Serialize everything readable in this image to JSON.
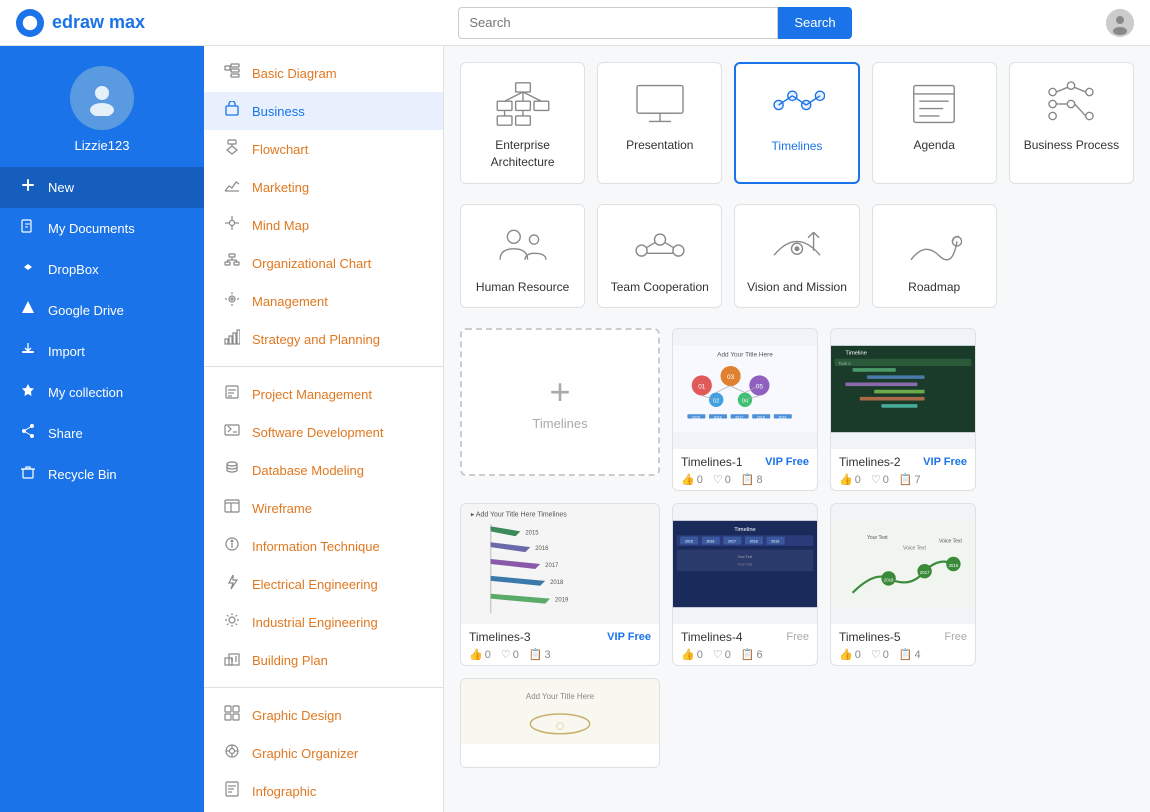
{
  "topbar": {
    "logo_letter": "D",
    "app_name": "edraw max",
    "search_placeholder": "Search",
    "search_button_label": "Search"
  },
  "sidebar": {
    "username": "Lizzie123",
    "nav_items": [
      {
        "id": "new",
        "label": "New",
        "icon": "➕",
        "active": true
      },
      {
        "id": "my-documents",
        "label": "My Documents",
        "icon": "📄"
      },
      {
        "id": "dropbox",
        "label": "DropBox",
        "icon": "📦"
      },
      {
        "id": "google-drive",
        "label": "Google Drive",
        "icon": "🔺"
      },
      {
        "id": "import",
        "label": "Import",
        "icon": "📥"
      },
      {
        "id": "my-collection",
        "label": "My collection",
        "icon": "⭐"
      },
      {
        "id": "share",
        "label": "Share",
        "icon": "🔗"
      },
      {
        "id": "recycle-bin",
        "label": "Recycle Bin",
        "icon": "🗑"
      }
    ]
  },
  "middle_menu": {
    "sections": [
      {
        "items": [
          {
            "id": "basic-diagram",
            "label": "Basic Diagram",
            "icon": "◻"
          },
          {
            "id": "business",
            "label": "Business",
            "icon": "💼",
            "selected": true
          },
          {
            "id": "flowchart",
            "label": "Flowchart",
            "icon": "⬜"
          },
          {
            "id": "marketing",
            "label": "Marketing",
            "icon": "📊"
          },
          {
            "id": "mind-map",
            "label": "Mind Map",
            "icon": "🔷"
          },
          {
            "id": "organizational-chart",
            "label": "Organizational Chart",
            "icon": "🏢"
          },
          {
            "id": "management",
            "label": "Management",
            "icon": "⚙"
          },
          {
            "id": "strategy-and-planning",
            "label": "Strategy and Planning",
            "icon": "📈"
          }
        ]
      },
      {
        "items": [
          {
            "id": "project-management",
            "label": "Project Management",
            "icon": "📋"
          },
          {
            "id": "software-development",
            "label": "Software Development",
            "icon": "💻"
          },
          {
            "id": "database-modeling",
            "label": "Database Modeling",
            "icon": "🗄"
          },
          {
            "id": "wireframe",
            "label": "Wireframe",
            "icon": "🖥"
          },
          {
            "id": "information-technique",
            "label": "Information Technique",
            "icon": "ℹ"
          },
          {
            "id": "electrical-engineering",
            "label": "Electrical Engineering",
            "icon": "⚡"
          },
          {
            "id": "industrial-engineering",
            "label": "Industrial Engineering",
            "icon": "🔧"
          },
          {
            "id": "building-plan",
            "label": "Building Plan",
            "icon": "🏗"
          }
        ]
      },
      {
        "items": [
          {
            "id": "graphic-design",
            "label": "Graphic Design",
            "icon": "🎨"
          },
          {
            "id": "graphic-organizer",
            "label": "Graphic Organizer",
            "icon": "🔣"
          },
          {
            "id": "infographic",
            "label": "Infographic",
            "icon": "📊"
          }
        ]
      }
    ]
  },
  "content": {
    "category_cards": [
      {
        "id": "enterprise-arch",
        "label": "Enterprise\nArchitecture",
        "selected": false
      },
      {
        "id": "presentation",
        "label": "Presentation",
        "selected": false
      },
      {
        "id": "timelines",
        "label": "Timelines",
        "selected": true
      },
      {
        "id": "agenda",
        "label": "Agenda",
        "selected": false
      },
      {
        "id": "business-process",
        "label": "Business Process",
        "selected": false
      },
      {
        "id": "human-resource",
        "label": "Human Resource",
        "selected": false
      },
      {
        "id": "team-cooperation",
        "label": "Team Cooperation",
        "selected": false
      },
      {
        "id": "vision-mission",
        "label": "Vision and Mission",
        "selected": false
      },
      {
        "id": "roadmap",
        "label": "Roadmap",
        "selected": false
      }
    ],
    "new_template_label": "Timelines",
    "templates": [
      {
        "id": "t1",
        "name": "Timelines-1",
        "badge": "VIP Free",
        "badge_type": "vip",
        "likes": 0,
        "hearts": 0,
        "copies": 8
      },
      {
        "id": "t2",
        "name": "Timelines-2",
        "badge": "VIP Free",
        "badge_type": "vip",
        "likes": 0,
        "hearts": 0,
        "copies": 7
      },
      {
        "id": "t3",
        "name": "Timelines-3",
        "badge": "VIP Free",
        "badge_type": "vip",
        "likes": 0,
        "hearts": 0,
        "copies": 3
      },
      {
        "id": "t4",
        "name": "Timelines-4",
        "badge": "Free",
        "badge_type": "free",
        "likes": 0,
        "hearts": 0,
        "copies": 6
      },
      {
        "id": "t5",
        "name": "Timelines-5",
        "badge": "Free",
        "badge_type": "free",
        "likes": 0,
        "hearts": 0,
        "copies": 4
      }
    ]
  }
}
